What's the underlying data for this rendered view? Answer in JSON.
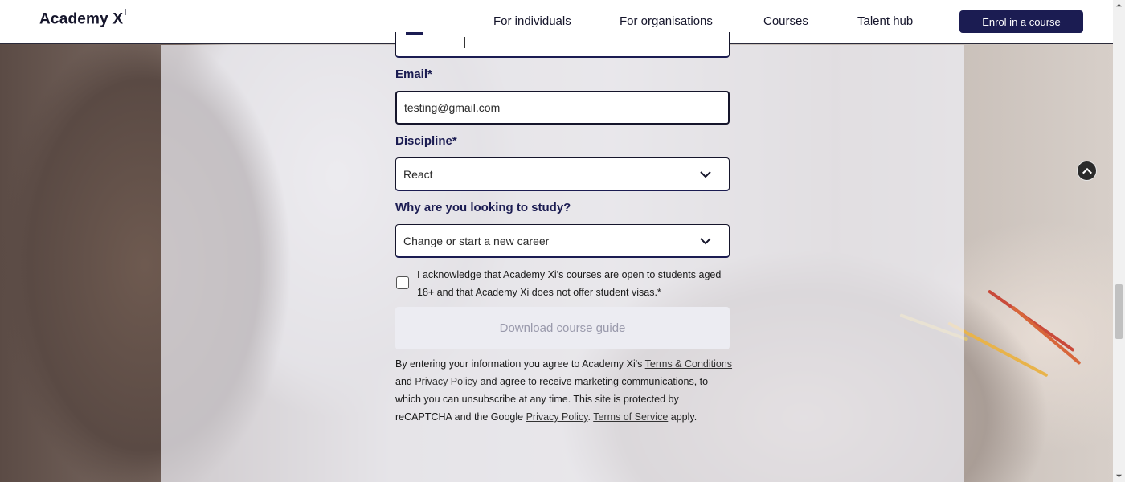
{
  "header": {
    "logo_text": "Academy X",
    "logo_sup": "i",
    "nav": [
      {
        "label": "For individuals"
      },
      {
        "label": "For organisations"
      },
      {
        "label": "Courses"
      },
      {
        "label": "Talent hub"
      }
    ],
    "cta_label": "Enrol in a course"
  },
  "form": {
    "email": {
      "label": "Email*",
      "value": "testing@gmail.com"
    },
    "discipline": {
      "label": "Discipline*",
      "value": "React"
    },
    "reason": {
      "label": "Why are you looking to study?",
      "value": "Change or start a new career"
    },
    "acknowledge_text": "I acknowledge that Academy Xi's courses are open to students aged 18+ and that Academy Xi does not offer student visas.*",
    "submit_label": "Download course guide",
    "legal": {
      "part1": "By entering your information you agree to Academy Xi's ",
      "terms_link": "Terms & Conditions",
      "part2": " and ",
      "privacy_link": "Privacy Policy",
      "part3": " and agree to receive marketing communications, to which you can unsubscribe at any time. This site is protected by reCAPTCHA and the Google ",
      "google_privacy_link": "Privacy Policy",
      "part4": ". ",
      "tos_link": "Terms of Service",
      "part5": " apply."
    }
  },
  "colors": {
    "brand_navy": "#1b1c52",
    "overlay": "#eeeef5"
  },
  "icons": {
    "select_chevron": "chevron-down-icon",
    "scroll_up": "chevron-up-icon"
  }
}
